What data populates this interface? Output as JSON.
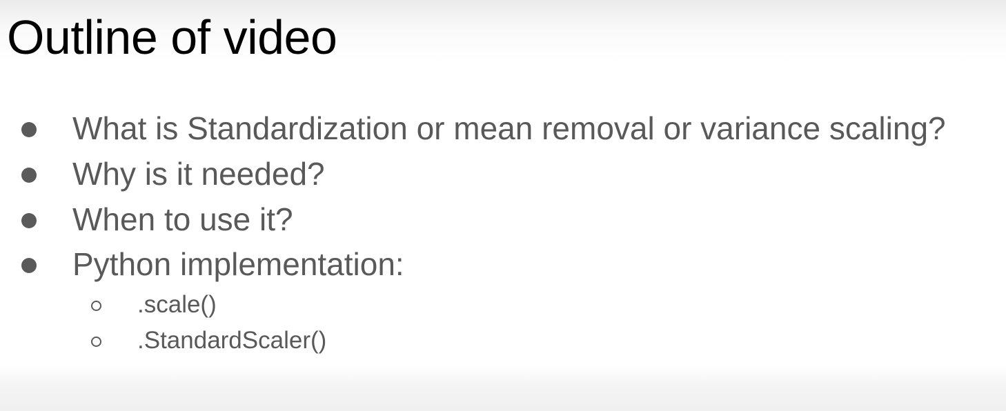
{
  "slide": {
    "title": "Outline of video",
    "bullets": [
      "What is Standardization or mean removal or variance scaling?",
      "Why is it needed?",
      "When to use it?",
      "Python implementation:"
    ],
    "sub_bullets": [
      ".scale()",
      ".StandardScaler()"
    ]
  },
  "colors": {
    "title": "#000000",
    "body_text": "#595959",
    "bullet": "#5a5a5a",
    "background": "#ffffff"
  }
}
